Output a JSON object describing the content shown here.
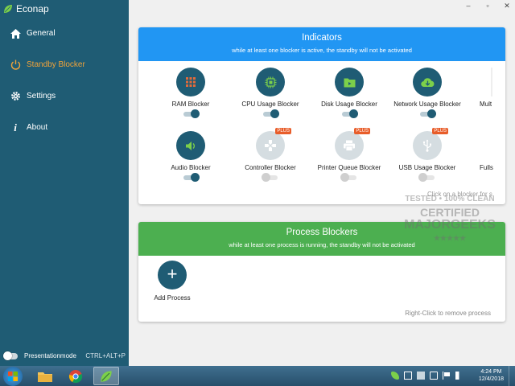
{
  "app": {
    "name": "Econap"
  },
  "window_controls": {
    "minimize": "–",
    "maximize": "▫",
    "close": "✕"
  },
  "nav": {
    "items": [
      {
        "label": "General",
        "icon": "home-icon",
        "active": false
      },
      {
        "label": "Standby Blocker",
        "icon": "power-icon",
        "active": true
      },
      {
        "label": "Settings",
        "icon": "gear-icon",
        "active": false
      },
      {
        "label": "About",
        "icon": "info-icon",
        "active": false
      }
    ]
  },
  "presentation": {
    "label": "Presentationmode",
    "shortcut": "CTRL+ALT+P",
    "enabled": false
  },
  "indicators": {
    "title": "Indicators",
    "subtitle": "while at least one blocker is active, the standby will not be activated",
    "hint": "Click on a blocker for s",
    "blockers": [
      {
        "label": "RAM Blocker",
        "icon": "ram-icon",
        "active": true,
        "plus": false
      },
      {
        "label": "CPU Usage Blocker",
        "icon": "cpu-icon",
        "active": true,
        "plus": false
      },
      {
        "label": "Disk Usage Blocker",
        "icon": "folder-icon",
        "active": true,
        "plus": false
      },
      {
        "label": "Network Usage Blocker",
        "icon": "cloud-download-icon",
        "active": true,
        "plus": false
      },
      {
        "label": "Mult",
        "icon": "",
        "active": false,
        "plus": false
      },
      {
        "label": "Audio Blocker",
        "icon": "speaker-icon",
        "active": true,
        "plus": false
      },
      {
        "label": "Controller Blocker",
        "icon": "gamepad-icon",
        "active": false,
        "plus": true
      },
      {
        "label": "Printer Queue Blocker",
        "icon": "printer-icon",
        "active": false,
        "plus": true
      },
      {
        "label": "USB Usage Blocker",
        "icon": "usb-icon",
        "active": false,
        "plus": true
      },
      {
        "label": "Fulls",
        "icon": "",
        "active": false,
        "plus": false
      }
    ],
    "plus_label": "PLUS"
  },
  "process": {
    "title": "Process Blockers",
    "subtitle": "while at least one process is running, the standby will not be activated",
    "add_label": "Add Process",
    "remove_hint": "Right-Click to remove process"
  },
  "watermark": {
    "lines": [
      "TESTED • 100% CLEAN",
      "CERTIFIED",
      "MAJORGEEKS",
      "★★★★★"
    ]
  },
  "taskbar": {
    "time": "4:24 PM",
    "date": "12/4/2018"
  },
  "colors": {
    "sidebar": "#1f5c74",
    "accent": "#f0a33a",
    "indicators": "#2196f3",
    "process": "#4caf50",
    "plus": "#e85d2a"
  }
}
